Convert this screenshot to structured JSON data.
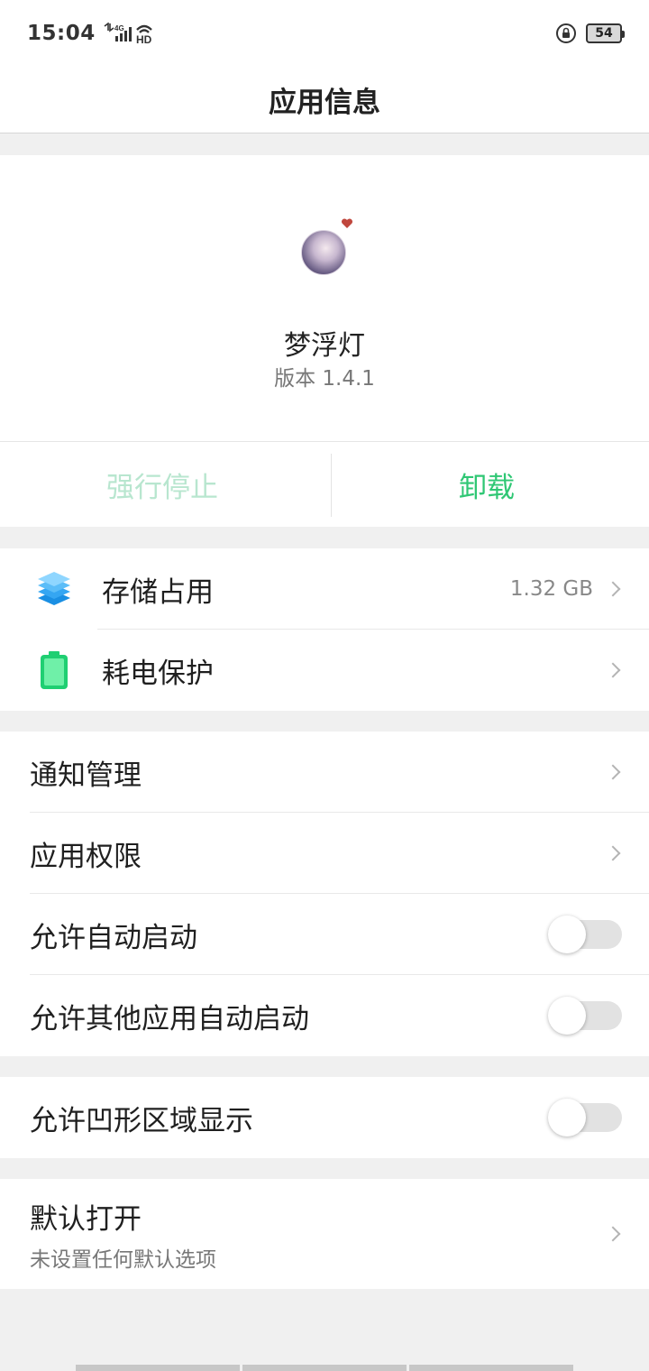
{
  "status_bar": {
    "time": "15:04",
    "network": "4G",
    "hd": "HD",
    "battery": "54"
  },
  "header": {
    "title": "应用信息"
  },
  "app": {
    "name": "梦浮灯",
    "version": "版本 1.4.1"
  },
  "actions": {
    "force_stop": "强行停止",
    "uninstall": "卸载"
  },
  "usage": {
    "storage_label": "存储占用",
    "storage_value": "1.32 GB",
    "battery_label": "耗电保护"
  },
  "settings": {
    "notifications": "通知管理",
    "permissions": "应用权限",
    "auto_start": "允许自动启动",
    "auto_start_on": false,
    "other_auto_start": "允许其他应用自动启动",
    "other_auto_start_on": false
  },
  "notch": {
    "label": "允许凹形区域显示",
    "on": false
  },
  "default_open": {
    "label": "默认打开",
    "sub": "未设置任何默认选项"
  },
  "colors": {
    "accent": "#2fc774",
    "accent_disabled": "#b8e6cf"
  }
}
